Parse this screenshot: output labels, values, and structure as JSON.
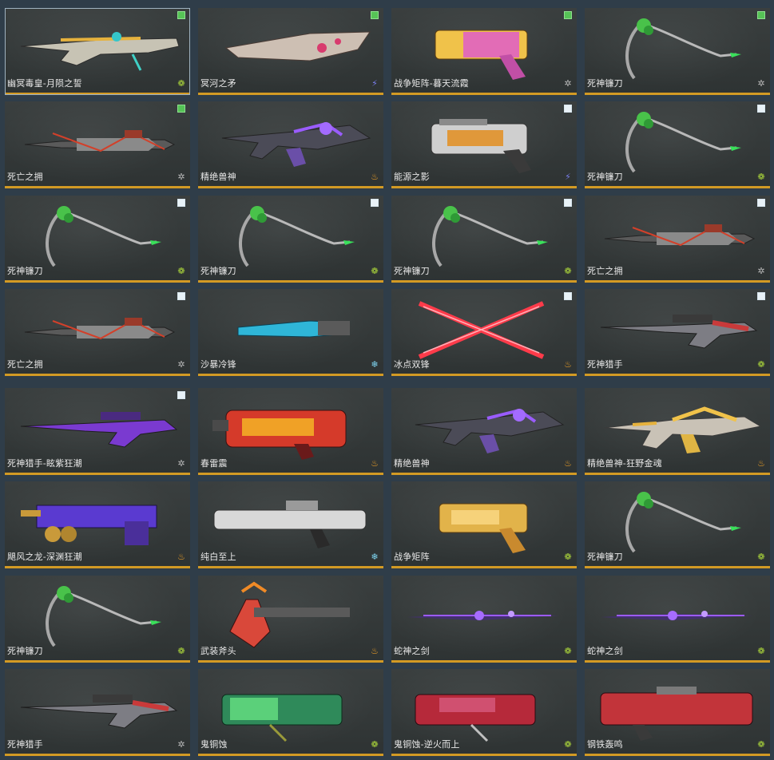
{
  "cards": [
    {
      "name": "幽冥毒皇-月陨之誓",
      "check": "green",
      "rarity": "star",
      "weapon": "rifle-gold",
      "selected": true
    },
    {
      "name": "冥河之矛",
      "check": "green",
      "rarity": "bolt",
      "weapon": "spear-white"
    },
    {
      "name": "战争矩阵-暮天流霞",
      "check": "green",
      "rarity": "wind",
      "weapon": "pistol-gold-pink"
    },
    {
      "name": "死神镰刀",
      "check": "green",
      "rarity": "wind",
      "weapon": "scythe"
    },
    {
      "name": "死亡之拥",
      "check": "green",
      "rarity": "wind",
      "weapon": "sword-dark"
    },
    {
      "name": "精绝兽神",
      "check": "none",
      "rarity": "fire",
      "weapon": "ak-purple"
    },
    {
      "name": "能源之影",
      "check": "white",
      "rarity": "bolt",
      "weapon": "pistol-white"
    },
    {
      "name": "死神镰刀",
      "check": "white",
      "rarity": "star",
      "weapon": "scythe"
    },
    {
      "name": "死神镰刀",
      "check": "white",
      "rarity": "star",
      "weapon": "scythe"
    },
    {
      "name": "死神镰刀",
      "check": "white",
      "rarity": "star",
      "weapon": "scythe"
    },
    {
      "name": "死神镰刀",
      "check": "white",
      "rarity": "star",
      "weapon": "scythe"
    },
    {
      "name": "死亡之拥",
      "check": "white",
      "rarity": "wind",
      "weapon": "sword-dark"
    },
    {
      "name": "死亡之拥",
      "check": "white",
      "rarity": "wind",
      "weapon": "sword-dark"
    },
    {
      "name": "沙暴冷锋",
      "check": "none",
      "rarity": "ice",
      "weapon": "knife-cyan"
    },
    {
      "name": "冰点双锋",
      "check": "white",
      "rarity": "fire",
      "weapon": "dual-red"
    },
    {
      "name": "死神猎手",
      "check": "white",
      "rarity": "star",
      "weapon": "sniper-red"
    },
    {
      "name": "死神猎手-眩紫狂潮",
      "check": "white",
      "rarity": "wind",
      "weapon": "sniper-purple"
    },
    {
      "name": "春雷震",
      "check": "none",
      "rarity": "fire",
      "weapon": "cannon-red"
    },
    {
      "name": "精绝兽神",
      "check": "none",
      "rarity": "fire",
      "weapon": "ak-purple"
    },
    {
      "name": "精绝兽神-狂野金魂",
      "check": "none",
      "rarity": "fire",
      "weapon": "ak-gold"
    },
    {
      "name": "飓风之龙-深渊狂潮",
      "check": "none",
      "rarity": "fire",
      "weapon": "gatling-purple"
    },
    {
      "name": "纯白至上",
      "check": "none",
      "rarity": "ice",
      "weapon": "gun-white"
    },
    {
      "name": "战争矩阵",
      "check": "none",
      "rarity": "star",
      "weapon": "pistol-gold"
    },
    {
      "name": "死神镰刀",
      "check": "none",
      "rarity": "star",
      "weapon": "scythe"
    },
    {
      "name": "死神镰刀",
      "check": "none",
      "rarity": "star",
      "weapon": "scythe"
    },
    {
      "name": "武装斧头",
      "check": "none",
      "rarity": "fire",
      "weapon": "axe-red"
    },
    {
      "name": "蛇神之剑",
      "check": "none",
      "rarity": "star",
      "weapon": "sword-purple"
    },
    {
      "name": "蛇神之剑",
      "check": "none",
      "rarity": "star",
      "weapon": "sword-purple"
    },
    {
      "name": "死神猎手",
      "check": "none",
      "rarity": "wind",
      "weapon": "sniper-red"
    },
    {
      "name": "鬼铜蚀",
      "check": "none",
      "rarity": "star",
      "weapon": "heavy-green"
    },
    {
      "name": "鬼铜蚀-逆火而上",
      "check": "none",
      "rarity": "star",
      "weapon": "heavy-red"
    },
    {
      "name": "钢铁轰鸣",
      "check": "none",
      "rarity": "star",
      "weapon": "heavy-red2"
    }
  ]
}
